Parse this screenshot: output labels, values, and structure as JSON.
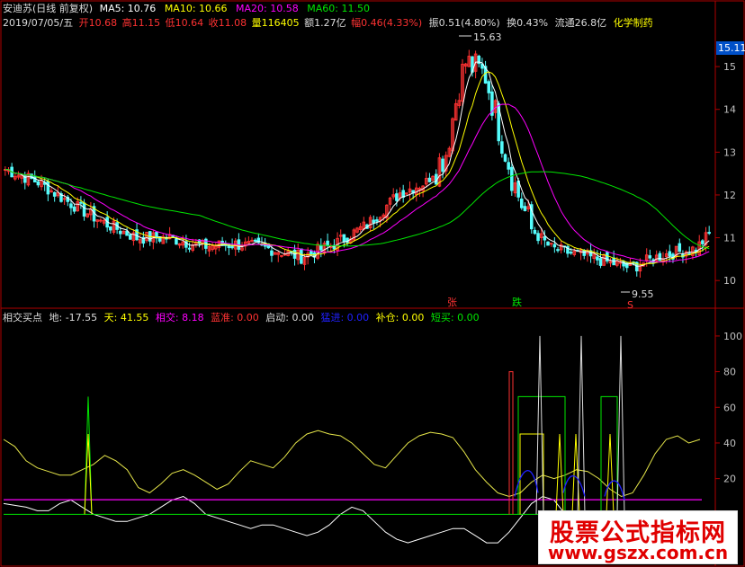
{
  "colors": {
    "bg": "#000000",
    "border": "#b00000",
    "up": "#ff3232",
    "down": "#54fcfc",
    "ma5": "#ffffff",
    "ma10": "#ffff00",
    "ma20": "#ff00ff",
    "ma60": "#00e600",
    "label_white": "#dcdcdc",
    "label_blue": "#2020ff",
    "label_orange": "#ff8000"
  },
  "header": {
    "stock": "安迪苏(日线 前复权)",
    "ma5": "MA5: 10.76",
    "ma10": "MA10: 10.66",
    "ma20": "MA20: 10.58",
    "ma60": "MA60: 11.50",
    "date": "2019/07/05/五",
    "open": "开10.68",
    "high": "高11.15",
    "low": "低10.64",
    "close": "收11.08",
    "volume": "量116405",
    "amount": "额1.27亿",
    "change": "幅0.46(4.33%)",
    "amplitude": "振0.51(4.80%)",
    "turnover": "换0.43%",
    "float_cap": "流通26.8亿",
    "sector": "化学制药"
  },
  "indicator_header": {
    "name": "相交买点",
    "di": "地: -17.55",
    "tian": "天: 41.55",
    "xiangjiao": "相交: 8.18",
    "lanzhun": "蓝准: 0.00",
    "qidong": "启动: 0.00",
    "mengjin": "猛进: 0.00",
    "bucang": "补仓: 0.00",
    "duanmai": "短买: 0.00"
  },
  "markers": {
    "zhang": "张",
    "die": "跌",
    "s": "S",
    "peak_label": "15.63",
    "low_label": "9.55"
  },
  "watermark": {
    "title": "股票公式指标网",
    "url": "www.gszx.com.cn"
  },
  "chart_data": [
    {
      "type": "candlestick",
      "title": "安迪苏(日线 前复权)",
      "ylim": [
        9.5,
        15.8
      ],
      "yticks": [
        10,
        11,
        12,
        13,
        14,
        15
      ],
      "last_price_tag": "15.11",
      "annotations": [
        {
          "text": "15.63",
          "x": "peak",
          "y": 15.63
        },
        {
          "text": "9.55",
          "x": "low",
          "y": 9.55
        }
      ],
      "price_path_keypoints": [
        [
          0,
          12.6
        ],
        [
          10,
          12.3
        ],
        [
          20,
          11.8
        ],
        [
          30,
          11.35
        ],
        [
          40,
          11.0
        ],
        [
          50,
          11.0
        ],
        [
          60,
          10.8
        ],
        [
          70,
          10.85
        ],
        [
          80,
          10.75
        ],
        [
          90,
          10.55
        ],
        [
          100,
          10.85
        ],
        [
          110,
          11.3
        ],
        [
          120,
          12.05
        ],
        [
          128,
          12.3
        ],
        [
          134,
          13.0
        ],
        [
          138,
          14.6
        ],
        [
          140,
          15.1
        ],
        [
          146,
          14.8
        ],
        [
          150,
          13.6
        ],
        [
          155,
          12.2
        ],
        [
          160,
          11.2
        ],
        [
          166,
          10.75
        ],
        [
          180,
          10.5
        ],
        [
          190,
          10.3
        ],
        [
          200,
          10.6
        ],
        [
          210,
          10.75
        ],
        [
          214,
          11.08
        ]
      ],
      "series": [
        {
          "name": "MA5",
          "values_ref": "computed"
        },
        {
          "name": "MA10",
          "values_ref": "computed"
        },
        {
          "name": "MA20",
          "values_ref": "computed"
        },
        {
          "name": "MA60",
          "values_ref": "computed"
        }
      ]
    },
    {
      "type": "line",
      "title": "相交买点",
      "ylim": [
        -20,
        105
      ],
      "yticks": [
        20,
        40,
        60,
        80,
        100
      ],
      "series": [
        {
          "name": "天",
          "color": "#e6e64a",
          "values": [
            42,
            38,
            30,
            26,
            24,
            22,
            22,
            25,
            28,
            33,
            30,
            25,
            15,
            12,
            17,
            23,
            25,
            22,
            18,
            14,
            17,
            24,
            30,
            28,
            26,
            32,
            40,
            45,
            47,
            45,
            44,
            40,
            34,
            28,
            26,
            33,
            40,
            44,
            46,
            45,
            43,
            35,
            25,
            18,
            12,
            10,
            12,
            18,
            22,
            20,
            22,
            25,
            24,
            20,
            14,
            10,
            12,
            22,
            34,
            42,
            44,
            40,
            42
          ]
        },
        {
          "name": "地",
          "color": "#ffffff",
          "values": [
            6,
            5,
            4,
            2,
            2,
            6,
            8,
            4,
            0,
            -2,
            -4,
            -4,
            -2,
            0,
            4,
            8,
            10,
            6,
            0,
            -2,
            -4,
            -6,
            -8,
            -6,
            -6,
            -8,
            -10,
            -12,
            -10,
            -6,
            0,
            4,
            2,
            -4,
            -10,
            -14,
            -16,
            -14,
            -12,
            -10,
            -8,
            -8,
            -12,
            -16,
            -16,
            -10,
            -2,
            6,
            10,
            8,
            0,
            -4,
            -8,
            -12,
            -14,
            -16,
            -14,
            -10,
            -6,
            -4,
            -2,
            -2,
            -2
          ]
        },
        {
          "name": "相交",
          "color": "#ff00ff",
          "values": [
            8.18
          ]
        }
      ]
    }
  ]
}
